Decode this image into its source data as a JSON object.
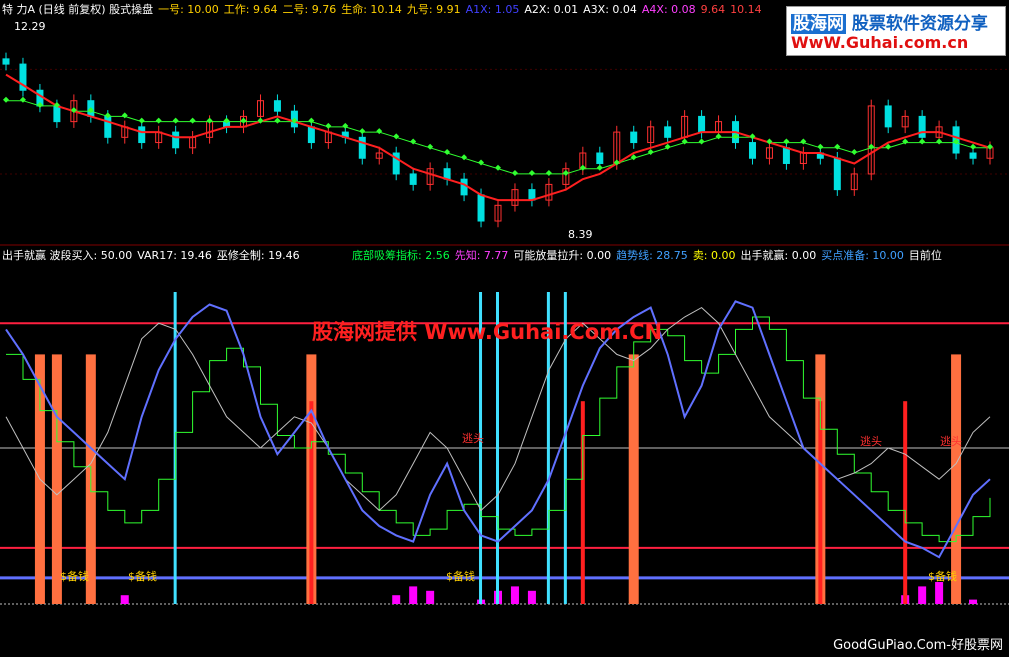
{
  "header_top": [
    {
      "text": "特 力A (日线 前复权) 股式操盘",
      "color": "#ffffff"
    },
    {
      "text": "一号: 10.00",
      "color": "#ffd000"
    },
    {
      "text": "工作: 9.64",
      "color": "#ffd000"
    },
    {
      "text": "二号: 9.76",
      "color": "#ffd000"
    },
    {
      "text": "生命: 10.14",
      "color": "#ffd000"
    },
    {
      "text": "九号: 9.91",
      "color": "#ffd000"
    },
    {
      "text": "A1X: 1.05",
      "color": "#4040ff"
    },
    {
      "text": "A2X: 0.01",
      "color": "#ffffff"
    },
    {
      "text": "A3X: 0.04",
      "color": "#ffffff"
    },
    {
      "text": "A4X: 0.08",
      "color": "#ff40ff"
    },
    {
      "text": "9.64",
      "color": "#ff4040"
    },
    {
      "text": "10.14",
      "color": "#ff4040"
    }
  ],
  "header_mid": [
    {
      "text": "出手就赢 波段买入: 50.00",
      "color": "#ffffff"
    },
    {
      "text": "VAR17: 19.46",
      "color": "#ffffff"
    },
    {
      "text": "巫修全制: 19.46",
      "color": "#ffffff"
    }
  ],
  "header_mid2": [
    {
      "text": "底部吸筹指标: 2.56",
      "color": "#00ff40"
    },
    {
      "text": "先知: 7.77",
      "color": "#ff40ff"
    },
    {
      "text": "可能放量拉升: 0.00",
      "color": "#ffffff"
    },
    {
      "text": "趋势线: 28.75",
      "color": "#40a0ff"
    },
    {
      "text": "卖: 0.00",
      "color": "#ffff00"
    },
    {
      "text": "出手就赢: 0.00",
      "color": "#ffffff"
    },
    {
      "text": "买点准备: 10.00",
      "color": "#40a0ff"
    },
    {
      "text": "目前位",
      "color": "#ffffff"
    }
  ],
  "price_labels": {
    "high": "12.29",
    "low": "8.39"
  },
  "logo": {
    "line1a": "股海网",
    "line1b": "股票软件资源分享",
    "line2": "WwW.Guhai.com.cn"
  },
  "watermark": "股海网提供 Www.Guhai.Com.CN",
  "footer": "GoodGuPiao.Com-好股票网",
  "signal_labels": {
    "buy": "$备钱",
    "sell": "逃头"
  },
  "colors": {
    "up": "#ff3030",
    "down": "#00e0e0",
    "ma_green": "#30ff30",
    "ma_red": "#ff2020",
    "orange": "#ff7040",
    "cyan": "#40e0ff",
    "blue": "#6070ff",
    "magenta": "#ff00ff",
    "level": "#ff2040"
  },
  "chart_data": {
    "type": "line",
    "price_range": [
      8.39,
      12.29
    ],
    "close": [
      11.6,
      11.1,
      10.8,
      10.5,
      10.9,
      10.6,
      10.2,
      10.4,
      10.1,
      10.3,
      10.0,
      10.2,
      10.5,
      10.4,
      10.6,
      10.9,
      10.7,
      10.4,
      10.1,
      10.3,
      10.2,
      9.8,
      9.9,
      9.5,
      9.3,
      9.6,
      9.4,
      9.1,
      8.6,
      8.9,
      9.2,
      9.0,
      9.3,
      9.6,
      9.9,
      9.7,
      10.3,
      10.1,
      10.4,
      10.2,
      10.6,
      10.3,
      10.5,
      10.1,
      9.8,
      10.0,
      9.7,
      9.9,
      9.8,
      9.2,
      9.5,
      10.8,
      10.4,
      10.6,
      10.2,
      10.4,
      9.9,
      9.8,
      10.0
    ],
    "ma_fast": [
      11.4,
      11.2,
      11.0,
      10.8,
      10.7,
      10.6,
      10.5,
      10.4,
      10.3,
      10.3,
      10.2,
      10.2,
      10.3,
      10.4,
      10.4,
      10.5,
      10.6,
      10.5,
      10.4,
      10.3,
      10.2,
      10.1,
      10.0,
      9.8,
      9.6,
      9.5,
      9.4,
      9.3,
      9.1,
      9.0,
      9.0,
      9.0,
      9.1,
      9.2,
      9.4,
      9.5,
      9.7,
      9.9,
      10.0,
      10.1,
      10.2,
      10.3,
      10.3,
      10.3,
      10.2,
      10.1,
      10.0,
      9.9,
      9.9,
      9.8,
      9.7,
      9.9,
      10.1,
      10.2,
      10.3,
      10.3,
      10.2,
      10.1,
      10.0
    ],
    "ma_slow": [
      10.9,
      10.9,
      10.8,
      10.8,
      10.7,
      10.7,
      10.6,
      10.6,
      10.5,
      10.5,
      10.5,
      10.5,
      10.5,
      10.5,
      10.5,
      10.5,
      10.5,
      10.5,
      10.5,
      10.4,
      10.4,
      10.3,
      10.3,
      10.2,
      10.1,
      10.0,
      9.9,
      9.8,
      9.7,
      9.6,
      9.5,
      9.5,
      9.5,
      9.5,
      9.6,
      9.6,
      9.7,
      9.8,
      9.9,
      10.0,
      10.1,
      10.1,
      10.2,
      10.2,
      10.2,
      10.1,
      10.1,
      10.1,
      10.0,
      10.0,
      9.9,
      10.0,
      10.0,
      10.1,
      10.1,
      10.1,
      10.1,
      10.0,
      10.0
    ],
    "lower_blue": [
      88,
      80,
      70,
      60,
      55,
      50,
      45,
      40,
      60,
      75,
      85,
      92,
      96,
      94,
      80,
      60,
      48,
      55,
      62,
      50,
      40,
      30,
      25,
      22,
      20,
      35,
      45,
      30,
      22,
      20,
      25,
      30,
      40,
      55,
      70,
      82,
      88,
      92,
      95,
      80,
      60,
      70,
      88,
      97,
      95,
      80,
      65,
      50,
      45,
      40,
      35,
      30,
      25,
      20,
      18,
      15,
      25,
      35,
      40
    ],
    "lower_thin": [
      60,
      50,
      40,
      35,
      40,
      45,
      55,
      70,
      85,
      90,
      88,
      80,
      70,
      60,
      55,
      50,
      55,
      60,
      58,
      50,
      40,
      35,
      30,
      35,
      45,
      55,
      50,
      40,
      30,
      35,
      45,
      60,
      75,
      85,
      90,
      85,
      80,
      78,
      82,
      88,
      92,
      95,
      90,
      80,
      70,
      60,
      55,
      50,
      45,
      40,
      42,
      45,
      50,
      48,
      44,
      40,
      45,
      55,
      60
    ],
    "lower_step": [
      80,
      72,
      62,
      52,
      44,
      36,
      30,
      26,
      30,
      40,
      55,
      68,
      78,
      82,
      76,
      64,
      54,
      50,
      52,
      48,
      42,
      36,
      30,
      26,
      22,
      24,
      30,
      32,
      28,
      24,
      22,
      24,
      30,
      40,
      54,
      66,
      76,
      84,
      88,
      86,
      78,
      74,
      80,
      88,
      92,
      88,
      78,
      66,
      56,
      48,
      42,
      36,
      30,
      26,
      22,
      20,
      22,
      28,
      34
    ],
    "buy_bars": [
      2,
      3,
      5,
      18,
      37,
      48,
      56
    ],
    "sell_bars": [
      18,
      34,
      48,
      53
    ],
    "cyan_bars": [
      10,
      28,
      29,
      32,
      33
    ],
    "levels": {
      "high": 90,
      "mid": 50,
      "low": 18
    }
  }
}
